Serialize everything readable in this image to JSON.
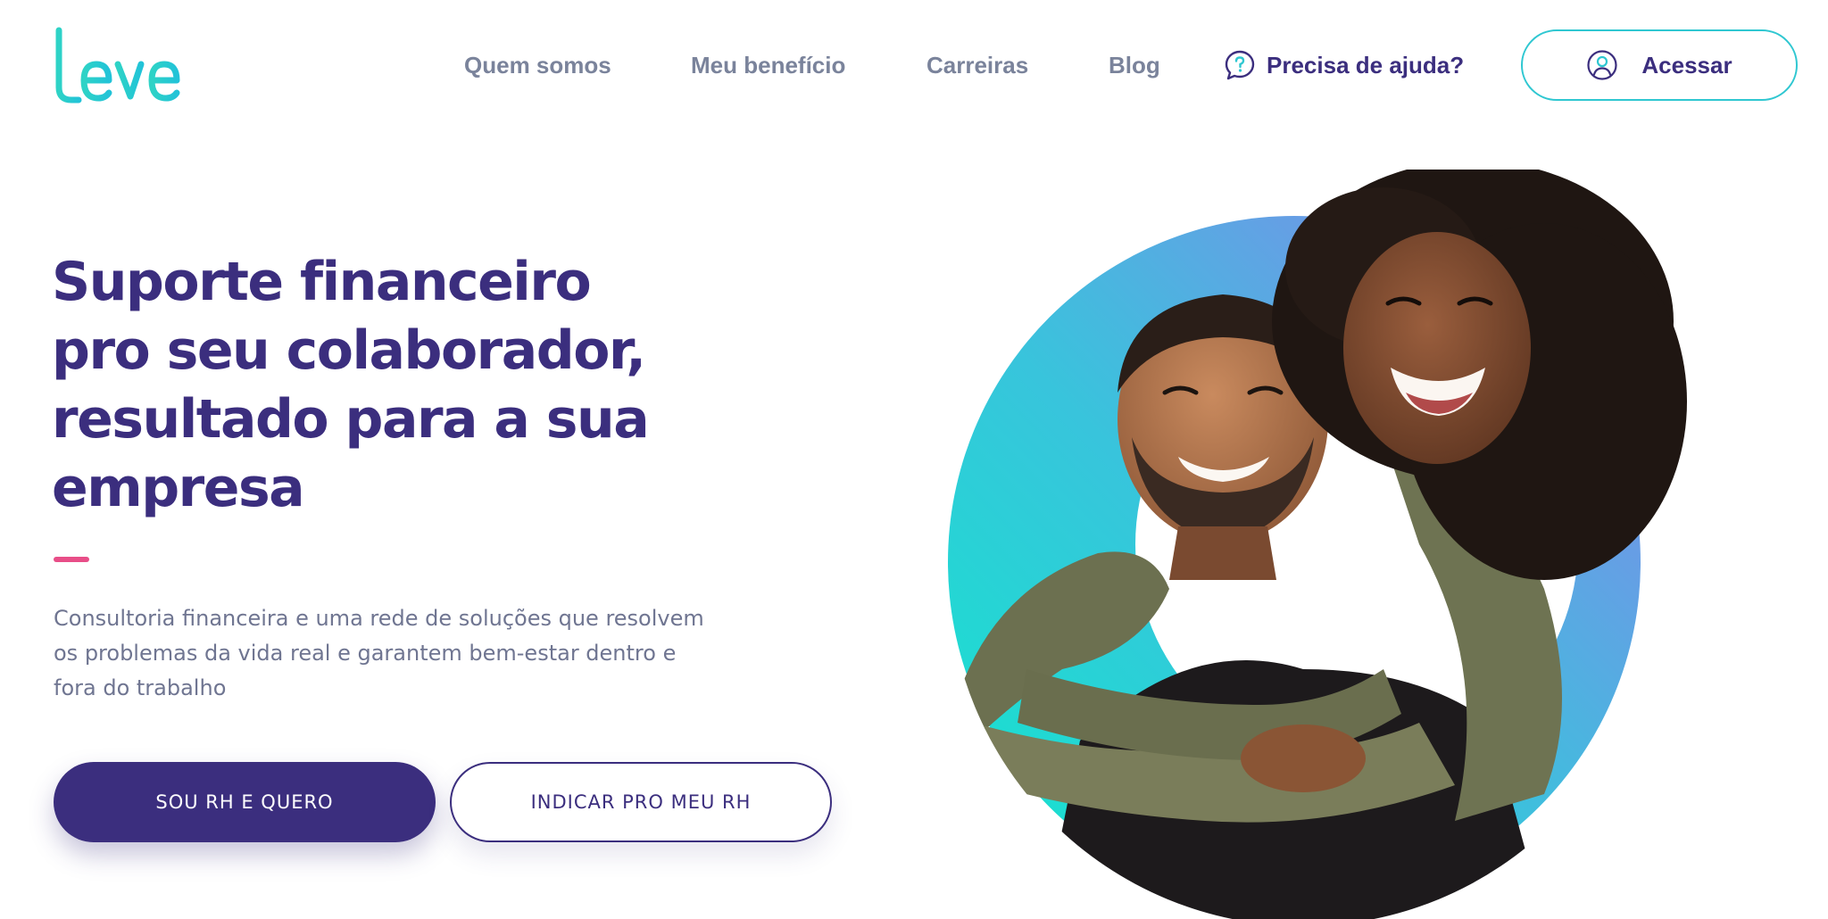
{
  "brand": {
    "logo_text": "Leve",
    "colors": {
      "teal": "#2fd6c6",
      "purple": "#3b2e7e",
      "pink": "#e84e88",
      "nav_gray": "#7a839b"
    }
  },
  "nav": {
    "links": [
      {
        "label": "Quem somos"
      },
      {
        "label": "Meu benefício"
      },
      {
        "label": "Carreiras"
      },
      {
        "label": "Blog"
      }
    ],
    "help": {
      "label": "Precisa de ajuda?",
      "icon": "question-bubble-icon"
    },
    "login": {
      "label": "Acessar",
      "icon": "user-icon"
    }
  },
  "hero": {
    "title_lines": [
      "Suporte financeiro",
      "pro seu colaborador,",
      "resultado para a sua",
      "empresa"
    ],
    "description_lines": [
      "Consultoria financeira e uma rede de soluções que resolvem",
      "os problemas da vida real e garantem bem-estar dentro e",
      "fora do trabalho"
    ],
    "primary_cta": "SOU RH E QUERO",
    "secondary_cta": "INDICAR PRO MEU RH",
    "image": "smiling-couple-photo"
  }
}
